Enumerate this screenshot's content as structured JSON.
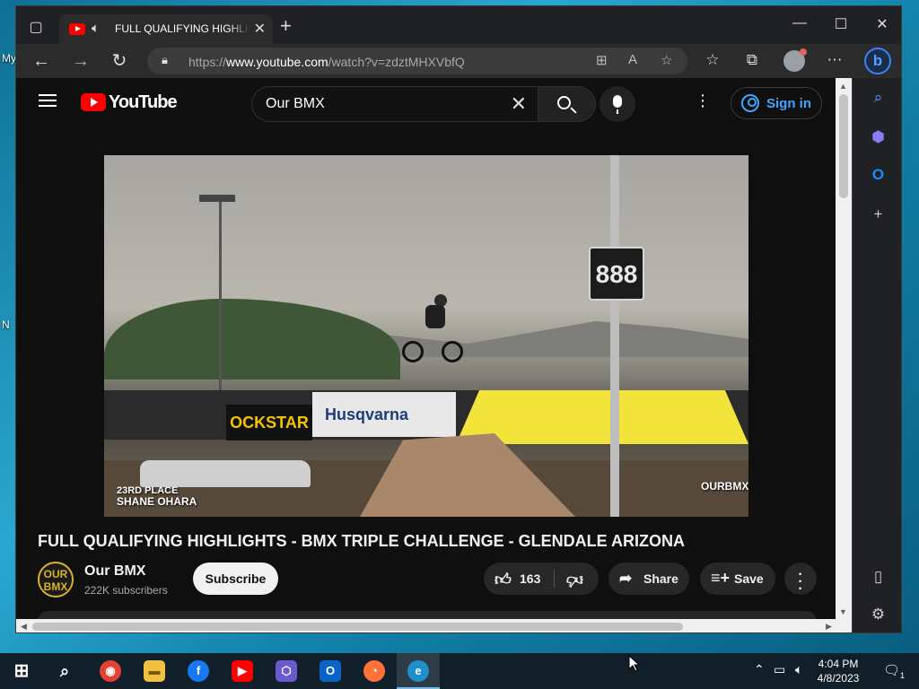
{
  "desktop": {
    "edge_labels": [
      "My",
      "N"
    ]
  },
  "tab": {
    "title": "FULL QUALIFYING HIGHLIGHTS - BMX TRIPLE CHALLENGE - GLENDALE ARIZONA"
  },
  "address_bar": {
    "url_prefix": "https://",
    "url_domain": "www.youtube.com",
    "url_path": "/watch?v=zdztMHXVbfQ"
  },
  "youtube": {
    "logo_text": "YouTube",
    "search_value": "Our BMX",
    "signin_label": "Sign in",
    "video_title": "FULL QUALIFYING HIGHLIGHTS - BMX TRIPLE CHALLENGE - GLENDALE ARIZONA",
    "channel": {
      "name": "Our BMX",
      "subscribers": "222K subscribers",
      "avatar_text": "OUR BMX"
    },
    "subscribe_label": "Subscribe",
    "likes": "163",
    "share_label": "Share",
    "save_label": "Save"
  },
  "video_frame": {
    "caption_place": "23RD PLACE",
    "caption_name": "SHANE OHARA",
    "sign_number": "888",
    "banner_left": "OCKSTAR",
    "banner_mid": "Husqvarna",
    "watermark": "OURBMX"
  },
  "taskbar": {
    "time": "4:04 PM",
    "date": "4/8/2023",
    "notification_count": "1"
  },
  "colors": {
    "youtube_red": "#ff0000",
    "signin_blue": "#3ea6ff",
    "accent": "#76b9ed"
  }
}
